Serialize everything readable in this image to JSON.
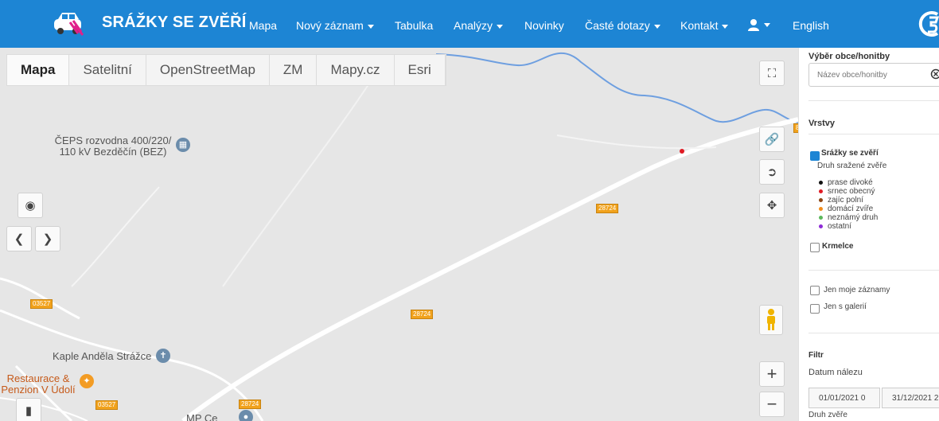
{
  "navbar": {
    "brand": "SRÁŽKY SE ZVĚŘÍ",
    "items": [
      {
        "label": "Mapa",
        "dropdown": false
      },
      {
        "label": "Nový záznam",
        "dropdown": true
      },
      {
        "label": "Tabulka",
        "dropdown": false
      },
      {
        "label": "Analýzy",
        "dropdown": true
      },
      {
        "label": "Novinky",
        "dropdown": false
      },
      {
        "label": "Časté dotazy",
        "dropdown": true
      },
      {
        "label": "Kontakt",
        "dropdown": true
      }
    ],
    "language": "English",
    "color": "#1d85d4"
  },
  "map": {
    "tabs": [
      "Mapa",
      "Satelitní",
      "OpenStreetMap",
      "ZM",
      "Mapy.cz",
      "Esri"
    ],
    "active_tab": "Mapa",
    "pois": {
      "ceps": "ČEPS rozvodna 400/220/ 110 kV Bezděčín (BEZ)",
      "kaple": "Kaple Anděla Strážce",
      "restaurace": "Restaurace & Penzion V Údolí",
      "mp": "MP Ce"
    },
    "roads": {
      "r1": "28724",
      "r2": "28724",
      "r3": "28724",
      "r4": "03527",
      "r5": "03527",
      "r6": "8"
    },
    "zoom_in": "+",
    "zoom_out": "−"
  },
  "panel": {
    "locality_heading": "Výběr obce/honitby",
    "locality_placeholder": "Název obce/honitby",
    "layers_heading": "Vrstvy",
    "collisions_label": "Srážky se zvěří",
    "collisions_checked": true,
    "species_heading": "Druh sražené zvěře",
    "species": [
      {
        "label": "prase divoké",
        "color": "#111111"
      },
      {
        "label": "srnec obecný",
        "color": "#e01b24"
      },
      {
        "label": "zajíc polní",
        "color": "#8b4513"
      },
      {
        "label": "domácí zvíře",
        "color": "#f28c1a"
      },
      {
        "label": "neznámý druh",
        "color": "#5cb85c"
      },
      {
        "label": "ostatní",
        "color": "#8e2bd6"
      }
    ],
    "feeders_label": "Krmelce",
    "only_mine_label": "Jen moje záznamy",
    "with_gallery_label": "Jen s galerií",
    "filter_heading": "Filtr",
    "date_label": "Datum nálezu",
    "date_from": "01/01/2021 0",
    "date_to": "31/12/2021 2",
    "species_filter_label": "Druh zvěře"
  }
}
